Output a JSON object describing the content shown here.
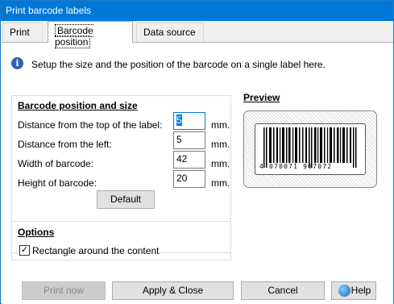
{
  "window": {
    "title": "Print barcode labels"
  },
  "tabs": [
    {
      "label": "Print",
      "active": false
    },
    {
      "label": "Barcode position",
      "active": true
    },
    {
      "label": "Data source",
      "active": false
    }
  ],
  "info": {
    "icon": "info-icon",
    "text": "Setup the size and the position of the barcode on a single label here."
  },
  "position_group": {
    "title": "Barcode position and size",
    "fields": [
      {
        "label": "Distance from the top of the label:",
        "value": "5",
        "unit": "mm."
      },
      {
        "label": "Distance from the left:",
        "value": "5",
        "unit": "mm."
      },
      {
        "label": "Width of barcode:",
        "value": "42",
        "unit": "mm."
      },
      {
        "label": "Height of barcode:",
        "value": "20",
        "unit": "mm."
      }
    ],
    "default_button": "Default"
  },
  "preview": {
    "title": "Preview",
    "barcode_digits": "4 070071 967072"
  },
  "options_group": {
    "title": "Options",
    "checkbox_label": "Rectangle around the content",
    "checked": true
  },
  "buttons": {
    "print_now": "Print now",
    "apply_close": "Apply & Close",
    "cancel": "Cancel",
    "help": "Help"
  },
  "colors": {
    "titlebar": "#0078d7",
    "selection": "#0078d7",
    "info_icon": "#2f5fb3"
  }
}
